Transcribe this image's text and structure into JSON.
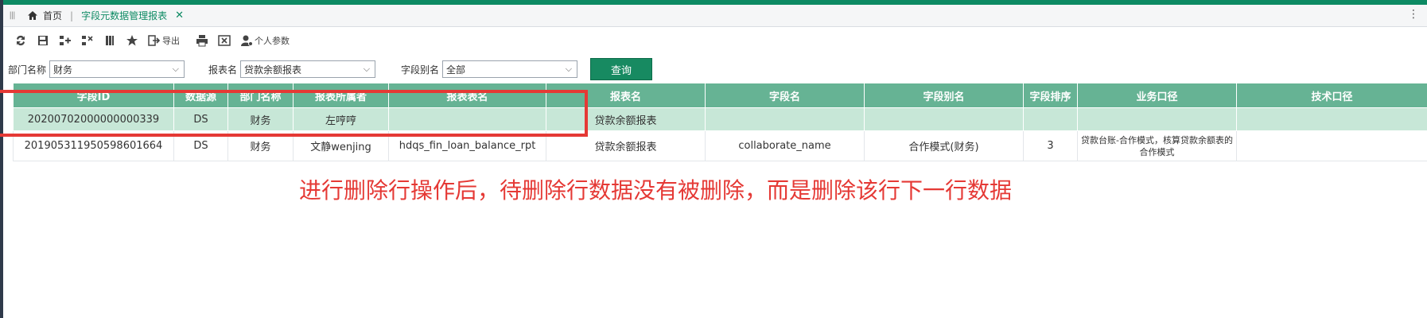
{
  "tabs": {
    "home_label": "首页",
    "active_label": "字段元数据管理报表"
  },
  "toolbar": {
    "export_label": "导出",
    "personal_label": "个人参数"
  },
  "filters": {
    "dept_label": "部门名称",
    "dept_value": "财务",
    "report_label": "报表名",
    "report_value": "贷款余额报表",
    "alias_label": "字段别名",
    "alias_value": "全部",
    "query_label": "查询"
  },
  "table": {
    "columns": [
      "字段ID",
      "数据源",
      "部门名称",
      "报表所属者",
      "报表表名",
      "报表名",
      "字段名",
      "字段别名",
      "字段排序",
      "业务口径",
      "技术口径"
    ],
    "rows": [
      [
        "20200702000000000339",
        "DS",
        "财务",
        "左哼哼",
        "",
        "贷款余额报表",
        "",
        "",
        "",
        "",
        ""
      ],
      [
        "20190531195059860166​4",
        "DS",
        "财务",
        "文静wenjing",
        "hdqs_fin_loan_balance_rpt",
        "贷款余额报表",
        "collaborate_name",
        "合作模式(财务)",
        "3",
        "贷款台账-合作模式，核算贷款余额表的合作模式",
        ""
      ]
    ]
  },
  "annotation": "进行删除行操作后，待删除行数据没有被删除，而是删除该行下一行数据",
  "colors": {
    "accent": "#0d8a63",
    "header_bg": "#66b394",
    "selected_row": "#c7e7d7",
    "annotation_red": "#e53935"
  }
}
